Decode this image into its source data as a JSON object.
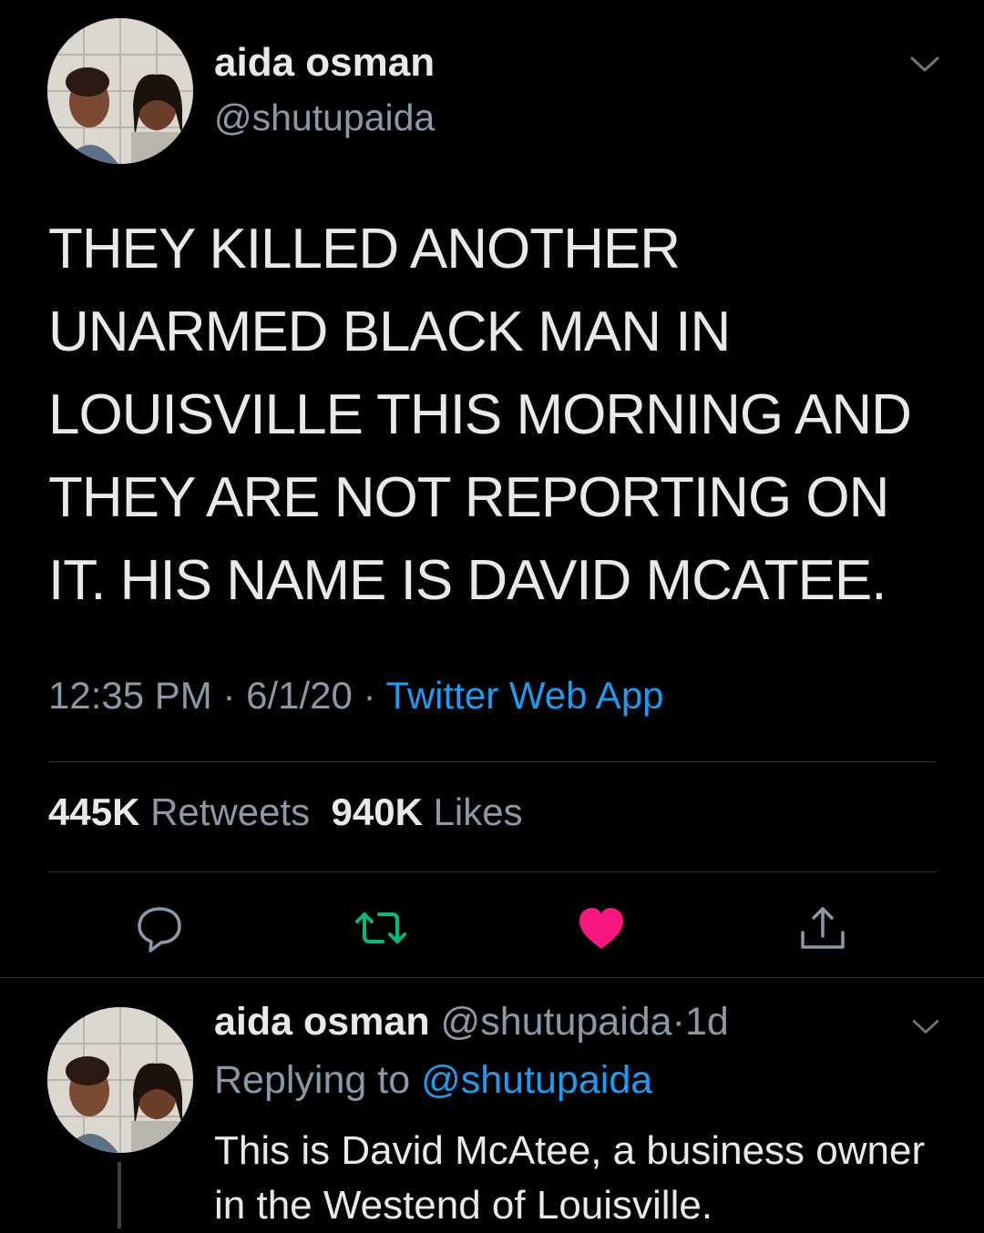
{
  "tweet": {
    "author_name": "aida osman",
    "author_handle": "@shutupaida",
    "text": "THEY KILLED ANOTHER UNARMED BLACK MAN IN LOUISVILLE THIS MORNING AND THEY ARE NOT REPORTING ON IT. HIS NAME IS DAVID MCATEE.",
    "time": "12:35 PM",
    "date": "6/1/20",
    "separator": "·",
    "source": "Twitter Web App",
    "retweets_count": "445K",
    "retweets_label": "Retweets",
    "likes_count": "940K",
    "likes_label": "Likes"
  },
  "actions": {
    "reply_icon": "reply-icon",
    "retweet_icon": "retweet-icon",
    "like_icon": "heart-icon",
    "share_icon": "share-icon"
  },
  "reply": {
    "author_name": "aida osman",
    "author_handle": "@shutupaida",
    "separator": "·",
    "age": "1d",
    "replying_label": "Replying to",
    "replying_handle": "@shutupaida",
    "text": "This is David McAtee, a business owner in the Westend of Louisville."
  },
  "colors": {
    "background": "#000000",
    "text": "#e7e9ea",
    "secondary": "#8b98a5",
    "link": "#1d9bf0",
    "retweet_green": "#00ba7c",
    "like_pink": "#f91880"
  }
}
